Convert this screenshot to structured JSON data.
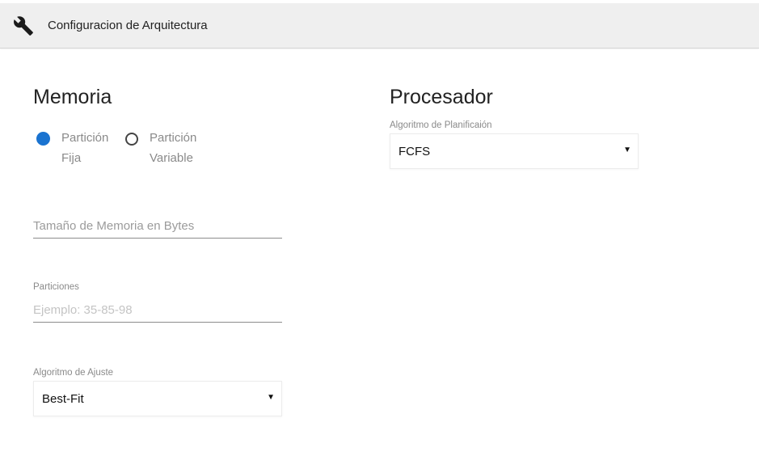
{
  "header": {
    "title": "Configuracion de Arquitectura",
    "icon": "wrench-icon"
  },
  "memoria": {
    "title": "Memoria",
    "partition_options": [
      {
        "label_line1": "Partición",
        "label_line2": "Fija",
        "selected": true
      },
      {
        "label_line1": "Partición",
        "label_line2": "Variable",
        "selected": false
      }
    ],
    "memory_size": {
      "placeholder": "Tamaño de Memoria en Bytes",
      "value": ""
    },
    "partitions": {
      "label": "Particiones",
      "placeholder": "Ejemplo: 35-85-98",
      "value": ""
    },
    "fit_algorithm": {
      "label": "Algoritmo de Ajuste",
      "selected": "Best-Fit"
    }
  },
  "procesador": {
    "title": "Procesador",
    "scheduling_algorithm": {
      "label": "Algoritmo de Planificaión",
      "selected": "FCFS"
    }
  },
  "colors": {
    "accent": "#1a73d0",
    "header_bg": "#efefef"
  }
}
